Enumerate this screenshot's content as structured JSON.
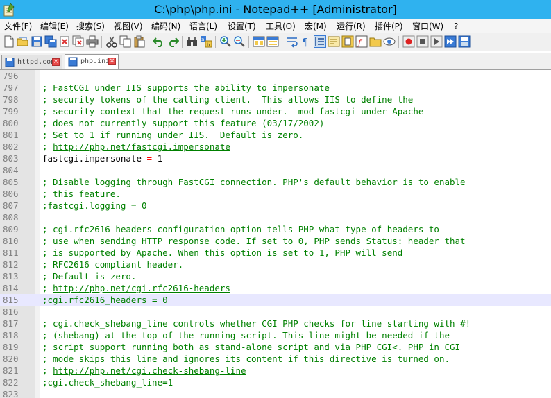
{
  "window": {
    "title": "C:\\php\\php.ini - Notepad++ [Administrator]"
  },
  "menu": [
    "文件(F)",
    "编辑(E)",
    "搜索(S)",
    "视图(V)",
    "编码(N)",
    "语言(L)",
    "设置(T)",
    "工具(O)",
    "宏(M)",
    "运行(R)",
    "插件(P)",
    "窗口(W)",
    "?"
  ],
  "toolbar": {
    "icons": [
      "new-file",
      "open-file",
      "save",
      "save-all",
      "close",
      "close-all",
      "print",
      "cut",
      "copy",
      "paste",
      "undo",
      "redo",
      "find",
      "replace",
      "zoom-in",
      "zoom-out",
      "sync-vertical",
      "sync-horizontal",
      "word-wrap",
      "show-all-chars",
      "indent-guide",
      "user-defined-language",
      "document-map",
      "function-list",
      "folder-as-workspace",
      "monitoring",
      "record-macro",
      "stop-recording",
      "play-macro",
      "run-macro-multiple",
      "save-macro"
    ]
  },
  "tabs": [
    {
      "label": "httpd.conf",
      "active": false
    },
    {
      "label": "php.ini",
      "active": true
    }
  ],
  "editor": {
    "current_line": 815,
    "lines": [
      {
        "num": "796",
        "tokens": []
      },
      {
        "num": "797",
        "tokens": [
          {
            "t": "comment",
            "v": "; FastCGI under IIS supports the ability to impersonate"
          }
        ]
      },
      {
        "num": "798",
        "tokens": [
          {
            "t": "comment",
            "v": "; security tokens of the calling client.  This allows IIS to define the"
          }
        ]
      },
      {
        "num": "799",
        "tokens": [
          {
            "t": "comment",
            "v": "; security context that the request runs under.  mod_fastcgi under Apache"
          }
        ]
      },
      {
        "num": "800",
        "tokens": [
          {
            "t": "comment",
            "v": "; does not currently support this feature (03/17/2002)"
          }
        ]
      },
      {
        "num": "801",
        "tokens": [
          {
            "t": "comment",
            "v": "; Set to 1 if running under IIS.  Default is zero."
          }
        ]
      },
      {
        "num": "802",
        "tokens": [
          {
            "t": "comment",
            "v": "; "
          },
          {
            "t": "url",
            "v": "http://php.net/fastcgi.impersonate"
          }
        ]
      },
      {
        "num": "803",
        "tokens": [
          {
            "t": "key",
            "v": "fastcgi.impersonate "
          },
          {
            "t": "op",
            "v": "="
          },
          {
            "t": "val",
            "v": " 1"
          }
        ]
      },
      {
        "num": "804",
        "tokens": []
      },
      {
        "num": "805",
        "tokens": [
          {
            "t": "comment",
            "v": "; Disable logging through FastCGI connection. PHP's default behavior is to enable"
          }
        ]
      },
      {
        "num": "806",
        "tokens": [
          {
            "t": "comment",
            "v": "; this feature."
          }
        ]
      },
      {
        "num": "807",
        "tokens": [
          {
            "t": "comment",
            "v": ";fastcgi.logging = 0"
          }
        ]
      },
      {
        "num": "808",
        "tokens": []
      },
      {
        "num": "809",
        "tokens": [
          {
            "t": "comment",
            "v": "; cgi.rfc2616_headers configuration option tells PHP what type of headers to"
          }
        ]
      },
      {
        "num": "810",
        "tokens": [
          {
            "t": "comment",
            "v": "; use when sending HTTP response code. If set to 0, PHP sends Status: header that"
          }
        ]
      },
      {
        "num": "811",
        "tokens": [
          {
            "t": "comment",
            "v": "; is supported by Apache. When this option is set to 1, PHP will send"
          }
        ]
      },
      {
        "num": "812",
        "tokens": [
          {
            "t": "comment",
            "v": "; RFC2616 compliant header."
          }
        ]
      },
      {
        "num": "813",
        "tokens": [
          {
            "t": "comment",
            "v": "; Default is zero."
          }
        ]
      },
      {
        "num": "814",
        "tokens": [
          {
            "t": "comment",
            "v": "; "
          },
          {
            "t": "url",
            "v": "http://php.net/cgi.rfc2616-headers"
          }
        ]
      },
      {
        "num": "815",
        "tokens": [
          {
            "t": "comment",
            "v": ";cgi.rfc2616_headers = 0"
          }
        ]
      },
      {
        "num": "816",
        "tokens": []
      },
      {
        "num": "817",
        "tokens": [
          {
            "t": "comment",
            "v": "; cgi.check_shebang_line controls whether CGI PHP checks for line starting with #!"
          }
        ]
      },
      {
        "num": "818",
        "tokens": [
          {
            "t": "comment",
            "v": "; (shebang) at the top of the running script. This line might be needed if the"
          }
        ]
      },
      {
        "num": "819",
        "tokens": [
          {
            "t": "comment",
            "v": "; script support running both as stand-alone script and via PHP CGI<. PHP in CGI"
          }
        ]
      },
      {
        "num": "820",
        "tokens": [
          {
            "t": "comment",
            "v": "; mode skips this line and ignores its content if this directive is turned on."
          }
        ]
      },
      {
        "num": "821",
        "tokens": [
          {
            "t": "comment",
            "v": "; "
          },
          {
            "t": "url",
            "v": "http://php.net/cgi.check-shebang-line"
          }
        ]
      },
      {
        "num": "822",
        "tokens": [
          {
            "t": "comment",
            "v": ";cgi.check_shebang_line=1"
          }
        ]
      },
      {
        "num": "823",
        "tokens": []
      }
    ]
  }
}
